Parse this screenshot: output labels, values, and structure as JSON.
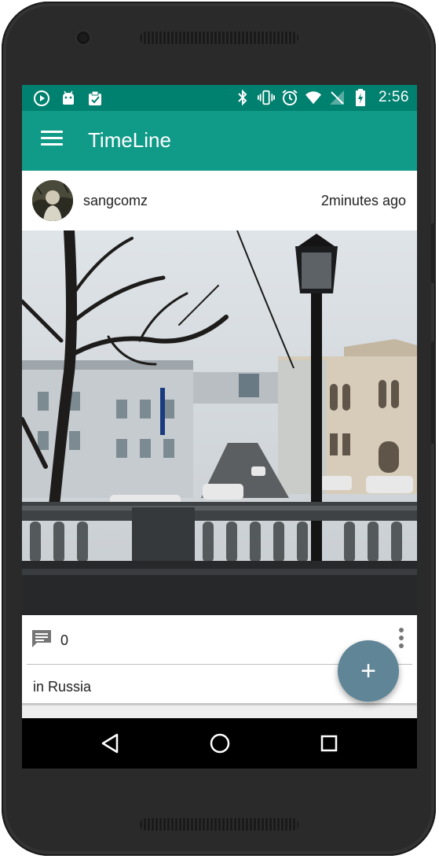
{
  "status_bar": {
    "time": "2:56",
    "left_icons": [
      "play-icon",
      "android-icon",
      "clipboard-check-icon"
    ],
    "right_icons": [
      "bluetooth-icon",
      "vibrate-icon",
      "alarm-icon",
      "wifi-icon",
      "no-signal-icon",
      "battery-charging-icon"
    ]
  },
  "app_bar": {
    "title": "TimeLine",
    "menu_icon": "hamburger-menu-icon"
  },
  "post": {
    "username": "sangcomz",
    "time_ago": "2minutes ago",
    "comment_count": "0",
    "location": "in Russia"
  },
  "fab": {
    "label": "+"
  },
  "colors": {
    "status_bar": "#00806f",
    "app_bar": "#109a88",
    "fab": "#5f8597"
  }
}
